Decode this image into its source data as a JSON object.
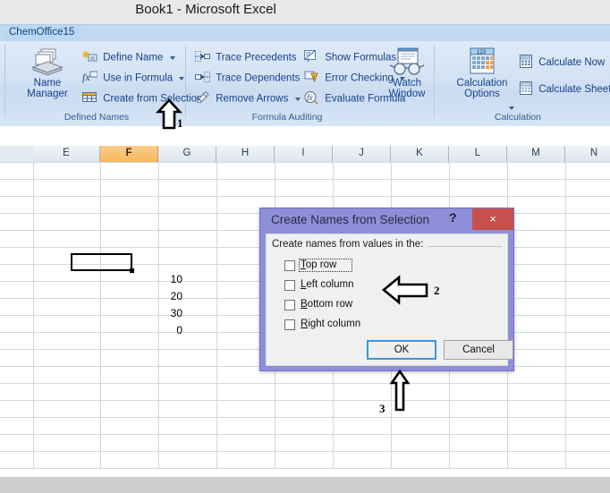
{
  "window": {
    "title": "Book1  -  Microsoft Excel"
  },
  "tabs": {
    "active": "ChemOffice15"
  },
  "ribbon": {
    "groups": [
      {
        "name": "defined-names",
        "label": "Defined Names",
        "big_button": {
          "line1": "Name",
          "line2": "Manager",
          "icon": "name-manager-icon"
        },
        "items": [
          {
            "label": "Define Name",
            "icon": "define-name-icon",
            "has_caret": true
          },
          {
            "label": "Use in Formula",
            "icon": "fx-icon",
            "has_caret": true
          },
          {
            "label": "Create from Selection",
            "icon": "create-from-selection-icon",
            "has_caret": false
          }
        ]
      },
      {
        "name": "formula-auditing",
        "label": "Formula Auditing",
        "items": [
          {
            "label": "Trace Precedents",
            "icon": "trace-precedents-icon",
            "has_caret": false
          },
          {
            "label": "Trace Dependents",
            "icon": "trace-dependents-icon",
            "has_caret": false
          },
          {
            "label": "Remove Arrows",
            "icon": "remove-arrows-icon",
            "has_caret": true
          },
          {
            "label": "Show Formulas",
            "icon": "show-formulas-icon",
            "has_caret": false
          },
          {
            "label": "Error Checking",
            "icon": "error-checking-icon",
            "has_caret": true
          },
          {
            "label": "Evaluate Formula",
            "icon": "evaluate-formula-icon",
            "has_caret": false
          }
        ],
        "big_button": {
          "line1": "Watch",
          "line2": "Window",
          "icon": "watch-window-icon"
        }
      },
      {
        "name": "calculation",
        "label": "Calculation",
        "big_button": {
          "line1": "Calculation",
          "line2": "Options",
          "icon": "calculation-options-icon",
          "has_caret": true
        },
        "items": [
          {
            "label": "Calculate Now",
            "icon": "calculate-now-icon",
            "has_caret": false
          },
          {
            "label": "Calculate Sheet",
            "icon": "calculate-sheet-icon",
            "has_caret": false
          }
        ]
      }
    ]
  },
  "sheet": {
    "column_headers": [
      "E",
      "F",
      "G",
      "H",
      "I",
      "J",
      "K",
      "L",
      "M",
      "N"
    ],
    "selected_column": "F",
    "selected_cell_column": "F",
    "cells": [
      {
        "column": "G",
        "value": "10"
      },
      {
        "column": "G",
        "value": "20"
      },
      {
        "column": "G",
        "value": "30"
      },
      {
        "column": "G",
        "value": "0"
      }
    ]
  },
  "dialog": {
    "title": "Create Names from Selection",
    "help_glyph": "?",
    "close_glyph": "×",
    "group_caption": "Create names from values in the:",
    "checkboxes": [
      {
        "label_pre": "",
        "accel": "T",
        "label_post": "op row",
        "checked": false,
        "focused": true
      },
      {
        "label_pre": "",
        "accel": "L",
        "label_post": "eft column",
        "checked": false,
        "focused": false
      },
      {
        "label_pre": "",
        "accel": "B",
        "label_post": "ottom row",
        "checked": false,
        "focused": false
      },
      {
        "label_pre": "",
        "accel": "R",
        "label_post": "ight column",
        "checked": false,
        "focused": false
      }
    ],
    "ok_label": "OK",
    "cancel_label": "Cancel"
  },
  "annotations": [
    {
      "id": "1",
      "label": "1",
      "shape": "arrow-up",
      "points_to": "create-from-selection-command"
    },
    {
      "id": "2",
      "label": "2",
      "shape": "arrow-left",
      "points_to": "checkbox-group"
    },
    {
      "id": "3",
      "label": "3",
      "shape": "arrow-up",
      "points_to": "ok-button"
    }
  ],
  "colors": {
    "title_bar": "#e8e8e8",
    "tab_strip": "#c3d9f0",
    "ribbon_text": "#15428b",
    "selected_column_header": "#f7b85c",
    "dialog_frame": "#8e8fd8",
    "dialog_close": "#c8504c",
    "default_button_border": "#3b97d3"
  }
}
